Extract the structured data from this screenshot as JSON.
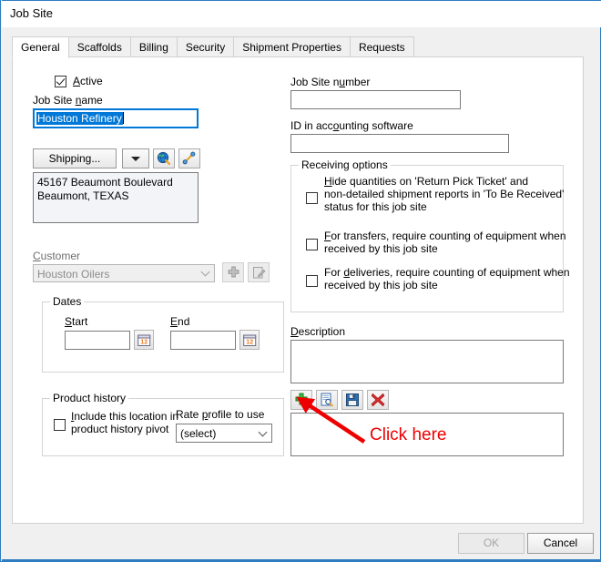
{
  "window": {
    "title": "Job Site",
    "accent": "#2f7cc0"
  },
  "tabs": [
    {
      "label": "General",
      "active": true
    },
    {
      "label": "Scaffolds",
      "active": false
    },
    {
      "label": "Billing",
      "active": false
    },
    {
      "label": "Security",
      "active": false
    },
    {
      "label": "Shipment Properties",
      "active": false
    },
    {
      "label": "Requests",
      "active": false
    }
  ],
  "left": {
    "active_checkbox": {
      "label": "Active",
      "checked": true
    },
    "job_site_name": {
      "label": "Job Site name",
      "value": "Houston Refinery",
      "selected": true
    },
    "address_type_button": {
      "label": "Shipping..."
    },
    "address": {
      "value_line1": "45167 Beaumont Boulevard",
      "value_line2": "Beaumont, TEXAS"
    },
    "customer": {
      "label": "Customer",
      "value": "Houston Oilers",
      "disabled": true
    },
    "dates": {
      "group_label": "Dates",
      "start_label": "Start",
      "start_value": "",
      "end_label": "End",
      "end_value": ""
    },
    "product_history": {
      "group_label": "Product history",
      "checkbox_label_line1": "Include this location in",
      "checkbox_label_line2": "product history pivot",
      "checked": false,
      "rate_profile_label": "Rate profile to use",
      "rate_profile_value": "(select)"
    }
  },
  "right": {
    "job_site_number": {
      "label": "Job Site number",
      "value": ""
    },
    "accounting_id": {
      "label": "ID in accounting software",
      "value": ""
    },
    "receiving_options": {
      "group_label": "Receiving options",
      "items": [
        {
          "checked": false,
          "lines": [
            "Hide quantities on 'Return Pick Ticket' and",
            "non-detailed shipment reports in 'To Be Received'",
            "status for this job site"
          ]
        },
        {
          "checked": false,
          "lines": [
            "For transfers, require counting of equipment when",
            "received by this job site"
          ]
        },
        {
          "checked": false,
          "lines": [
            "For deliveries, require counting of equipment when",
            "received by this job site"
          ]
        }
      ]
    },
    "description": {
      "label": "Description",
      "value": ""
    },
    "attachment_toolbar": [
      {
        "icon": "plus-icon",
        "name": "add-attachment-button"
      },
      {
        "icon": "document-preview-icon",
        "name": "preview-attachment-button"
      },
      {
        "icon": "floppy-save-icon",
        "name": "save-attachment-button"
      },
      {
        "icon": "red-x-icon",
        "name": "delete-attachment-button"
      }
    ],
    "attachment_list": {
      "value": ""
    }
  },
  "annotation": {
    "text": "Click here",
    "color": "#ee0000"
  },
  "footer": {
    "ok_label": "OK",
    "ok_disabled": true,
    "cancel_label": "Cancel"
  }
}
